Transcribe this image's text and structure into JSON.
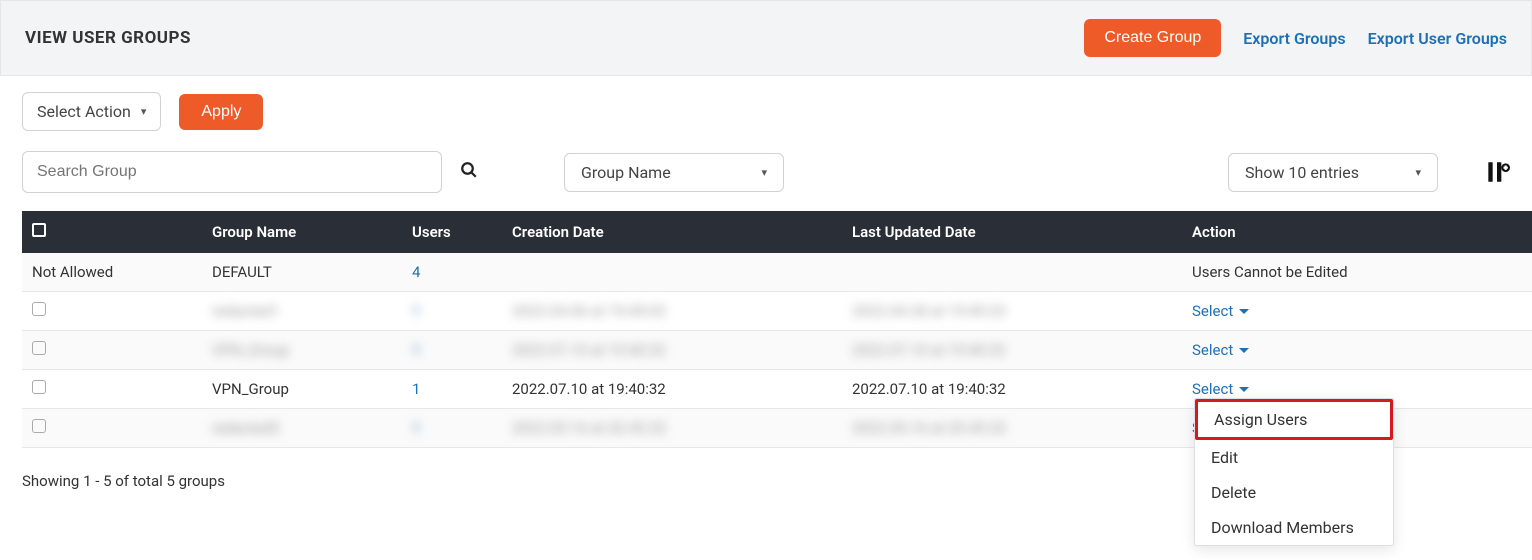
{
  "header": {
    "title": "VIEW USER GROUPS",
    "create_btn": "Create Group",
    "export_groups": "Export Groups",
    "export_user_groups": "Export User Groups"
  },
  "toolbar": {
    "select_action": "Select Action",
    "apply": "Apply"
  },
  "filters": {
    "search_placeholder": "Search Group",
    "group_name": "Group Name",
    "entries": "Show 10 entries"
  },
  "columns": {
    "check": "",
    "group": "Group Name",
    "users": "Users",
    "created": "Creation Date",
    "updated": "Last Updated Date",
    "action": "Action"
  },
  "rows": [
    {
      "check_text": "Not Allowed",
      "group": "DEFAULT",
      "users": "4",
      "created": "",
      "updated": "",
      "action_text": "Users Cannot be Edited",
      "action_type": "text",
      "blurred": false
    },
    {
      "check_text": "",
      "group": "redacted1",
      "users": "1",
      "created": "2022.04.06 at 19:49:03",
      "updated": "2022.04.28 at 19:49:23",
      "action_text": "Select",
      "action_type": "select",
      "blurred": true
    },
    {
      "check_text": "",
      "group": "VPN_Group",
      "users": "1",
      "created": "2022.07.10 at 19:40:32",
      "updated": "2022.07.10 at 19:40:32",
      "action_text": "Select",
      "action_type": "select",
      "blurred": true
    },
    {
      "check_text": "",
      "group": "VPN_Group",
      "users": "1",
      "created": "2022.07.10 at 19:40:32",
      "updated": "2022.07.10 at 19:40:32",
      "action_text": "Select",
      "action_type": "select",
      "blurred": false,
      "open": true
    },
    {
      "check_text": "",
      "group": "redacted5",
      "users": "1",
      "created": "2022.05.16 at 20.45.32",
      "updated": "2022.05.16 at 20.45.32",
      "action_text": "Select",
      "action_type": "select",
      "blurred": true
    }
  ],
  "dropdown": {
    "assign": "Assign Users",
    "edit": "Edit",
    "delete": "Delete",
    "download": "Download Members"
  },
  "status": "Showing 1 - 5 of total 5 groups"
}
